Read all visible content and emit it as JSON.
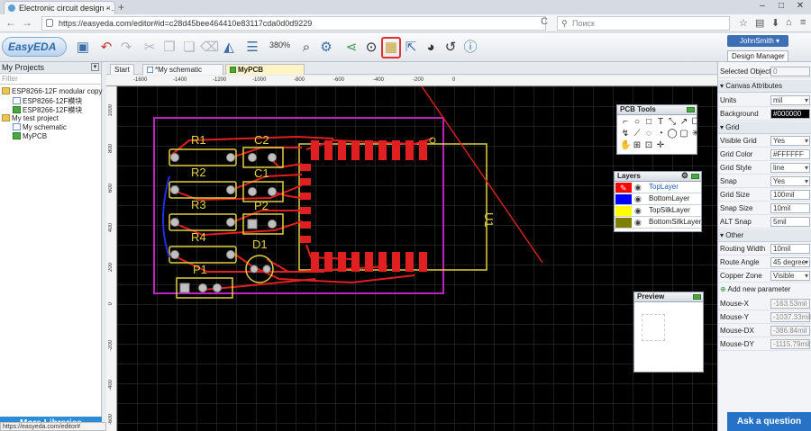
{
  "browser": {
    "tab_title": "Electronic circuit design - ...",
    "tab_close": "×",
    "new_tab": "+",
    "url": "https://easyeda.com/editor#id=c28d45bee464410e83117cda0d0d9229",
    "search_placeholder": "Поиск",
    "back": "←",
    "forward": "→",
    "reload": "C",
    "minimize": "–",
    "maximize": "□",
    "close": "✕"
  },
  "toolbar": {
    "logo": "EasyEDA",
    "zoom": "380%",
    "user": "JohnSmith",
    "design_manager": "Design Manager"
  },
  "left_panel": {
    "title": "My Projects",
    "filter_placeholder": "Filter",
    "tree": [
      {
        "label": "ESP8266-12F modular copy",
        "type": "folder"
      },
      {
        "label": "ESP8266-12F模块",
        "type": "sch"
      },
      {
        "label": "ESP8266-12F模块",
        "type": "pcb"
      },
      {
        "label": "My test project",
        "type": "folder"
      },
      {
        "label": "My schematic",
        "type": "sch"
      },
      {
        "label": "MyPCB",
        "type": "pcb"
      }
    ],
    "more_libraries": "More Libraries",
    "status_url": "https://easyeda.com/editor#"
  },
  "doc_tabs": [
    {
      "label": "Start"
    },
    {
      "label": "*My schematic"
    },
    {
      "label": "MyPCB"
    }
  ],
  "ruler": {
    "top": [
      "-1600",
      "-1400",
      "-1200",
      "-1000",
      "-800",
      "-600",
      "-400",
      "-200",
      "0"
    ],
    "left": [
      "1000",
      "800",
      "600",
      "400",
      "200",
      "0",
      "-200",
      "-400",
      "-600",
      "-800"
    ]
  },
  "pcb": {
    "components": [
      "R1",
      "R2",
      "R3",
      "R4",
      "C2",
      "C1",
      "P2",
      "D1",
      "P1",
      "U1"
    ]
  },
  "pcb_tools": {
    "title": "PCB Tools",
    "icons": [
      "⌐",
      "○",
      "□",
      "T",
      "⤡",
      "↗",
      "☐",
      "↯",
      "⟋",
      "◌",
      "◔",
      "◯",
      "▢",
      "✳",
      "✋",
      "⊞",
      "⊡",
      "✛"
    ]
  },
  "layers": {
    "title": "Layers",
    "items": [
      {
        "name": "TopLayer",
        "color": "#ff0000"
      },
      {
        "name": "BottomLayer",
        "color": "#0000ff"
      },
      {
        "name": "TopSilkLayer",
        "color": "#ffff00"
      },
      {
        "name": "BottomSilkLayer",
        "color": "#808000"
      }
    ]
  },
  "preview": {
    "title": "Preview"
  },
  "right_panel": {
    "selected_objects_label": "Selected Objects",
    "selected_objects_value": "0",
    "canvas_section": "Canvas Attributes",
    "units_label": "Units",
    "units_value": "mil",
    "background_label": "Background",
    "background_value": "#000000",
    "grid_section": "Grid",
    "visible_grid_label": "Visible Grid",
    "visible_grid_value": "Yes",
    "grid_color_label": "Grid Color",
    "grid_color_value": "#FFFFFF",
    "grid_style_label": "Grid Style",
    "grid_style_value": "line",
    "snap_label": "Snap",
    "snap_value": "Yes",
    "grid_size_label": "Grid Size",
    "grid_size_value": "100mil",
    "snap_size_label": "Snap Size",
    "snap_size_value": "10mil",
    "alt_snap_label": "ALT Snap",
    "alt_snap_value": "5mil",
    "other_section": "Other",
    "routing_width_label": "Routing Width",
    "routing_width_value": "10mil",
    "route_angle_label": "Route Angle",
    "route_angle_value": "45 degree",
    "copper_zone_label": "Copper Zone",
    "copper_zone_value": "Visible",
    "add_param": "Add new parameter",
    "mouse_x_label": "Mouse-X",
    "mouse_x_value": "-163.53mil",
    "mouse_y_label": "Mouse-Y",
    "mouse_y_value": "-1037.33mil",
    "mouse_dx_label": "Mouse-DX",
    "mouse_dx_value": "-386.84mil",
    "mouse_dy_label": "Mouse-DY",
    "mouse_dy_value": "-1115.79mil",
    "ask": "Ask a question"
  }
}
